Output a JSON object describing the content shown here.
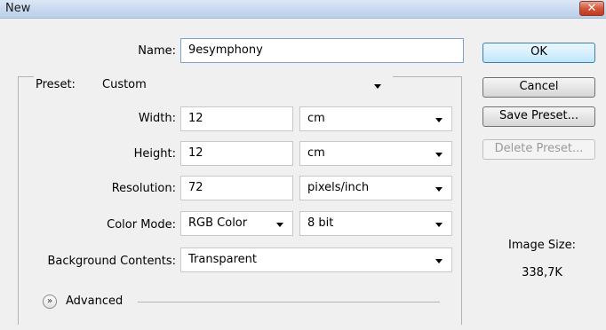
{
  "window": {
    "title": "New",
    "close_glyph": "✕"
  },
  "name_row": {
    "label": "Name:",
    "value": "9esymphony"
  },
  "preset": {
    "label": "Preset:",
    "value": "Custom"
  },
  "width": {
    "label": "Width:",
    "value": "12",
    "unit": "cm"
  },
  "height": {
    "label": "Height:",
    "value": "12",
    "unit": "cm"
  },
  "resolution": {
    "label": "Resolution:",
    "value": "72",
    "unit": "pixels/inch"
  },
  "color_mode": {
    "label": "Color Mode:",
    "mode": "RGB Color",
    "depth": "8 bit"
  },
  "background": {
    "label": "Background Contents:",
    "value": "Transparent"
  },
  "advanced": {
    "label": "Advanced",
    "icon": "double-chevron-down-icon"
  },
  "buttons": {
    "ok": "OK",
    "cancel": "Cancel",
    "save_preset": "Save Preset...",
    "delete_preset": "Delete Preset..."
  },
  "image_size": {
    "label": "Image Size:",
    "value": "338,7K"
  }
}
